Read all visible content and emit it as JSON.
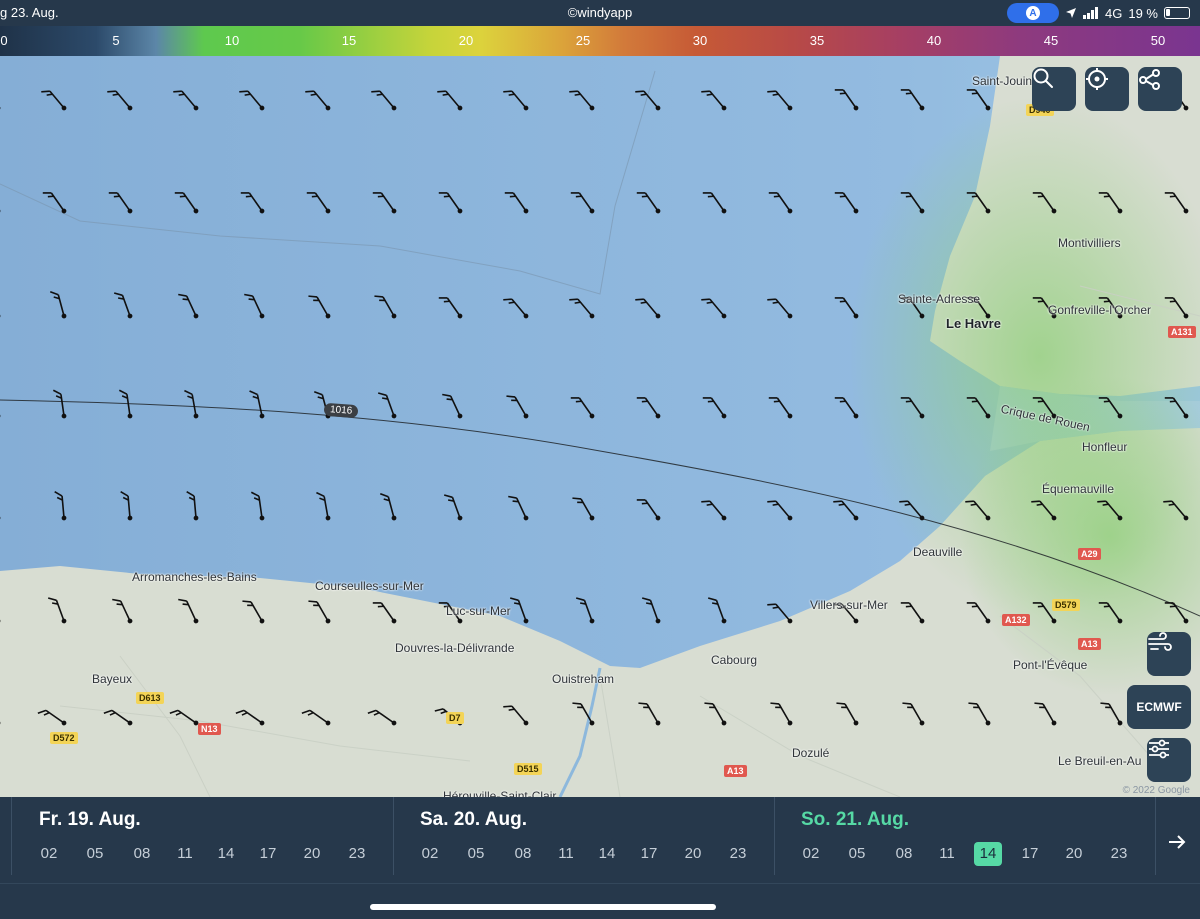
{
  "status_bar": {
    "date": "g 23. Aug.",
    "app_credit": "©windyapp",
    "location_pill": "A",
    "signal": "4G",
    "battery": "19 %"
  },
  "legend": {
    "unit_note": "",
    "stops": [
      "0",
      "5",
      "10",
      "15",
      "20",
      "25",
      "30",
      "35",
      "40",
      "45",
      "50"
    ]
  },
  "map": {
    "isobar_label": "1016",
    "copyright": "© 2022 Google",
    "places": {
      "saint_jouin": "Saint-Jouin",
      "montivilliers": "Montivilliers",
      "sainte_adresse": "Sainte-Adresse",
      "le_havre": "Le Havre",
      "gonfreville": "Gonfreville-l'Orcher",
      "crique": "Crique de Rouen",
      "honfleur": "Honfleur",
      "equemauville": "Équemauville",
      "deauville": "Deauville",
      "villers": "Villers-sur-Mer",
      "arromanches": "Arromanches-les-Bains",
      "courseulles": "Courseulles-sur-Mer",
      "luc": "Luc-sur-Mer",
      "douvres": "Douvres-la-Délivrande",
      "cabourg": "Cabourg",
      "ouistreham": "Ouistreham",
      "bayeux": "Bayeux",
      "pont_leveque": "Pont-l'Évêque",
      "dozule": "Dozulé",
      "le_breuil": "Le Breuil-en-Au",
      "herouville": "Hérouville-Saint-Clair"
    },
    "roads": [
      "D940",
      "A131",
      "A29",
      "D579",
      "A132",
      "A13",
      "A13",
      "D613",
      "N13",
      "D572",
      "D7",
      "D515"
    ],
    "buttons": {
      "search": "search",
      "locate": "locate",
      "share": "share",
      "wind_layer": "wind",
      "model": "ECMWF",
      "settings": "filters"
    }
  },
  "wind": {
    "unit": "",
    "barb_angles_deg": [
      [
        -40,
        -40,
        -40,
        -40,
        -40,
        -40,
        -40,
        -40,
        -40,
        -40,
        -40,
        -40,
        -40,
        -35,
        -35,
        -35,
        -35,
        -35,
        -35
      ],
      [
        -35,
        -35,
        -35,
        -35,
        -35,
        -35,
        -35,
        -35,
        -35,
        -35,
        -35,
        -35,
        -35,
        -35,
        -35,
        -35,
        -35,
        -35,
        -35
      ],
      [
        -15,
        -15,
        -20,
        -25,
        -25,
        -30,
        -30,
        -35,
        -40,
        -40,
        -40,
        -40,
        -40,
        -35,
        -35,
        -35,
        -35,
        -35,
        -35
      ],
      [
        -10,
        -8,
        -8,
        -10,
        -12,
        -15,
        -20,
        -25,
        -30,
        -35,
        -35,
        -35,
        -35,
        -35,
        -35,
        -35,
        -35,
        -35,
        -35
      ],
      [
        -8,
        -5,
        -5,
        -5,
        -8,
        -10,
        -15,
        -20,
        -25,
        -30,
        -35,
        -40,
        -40,
        -40,
        -40,
        -40,
        -40,
        -40,
        -40
      ],
      [
        -20,
        -20,
        -25,
        -25,
        -30,
        -30,
        -35,
        -35,
        -20,
        -20,
        -20,
        -20,
        -40,
        -40,
        -35,
        -35,
        -35,
        -35,
        -35
      ],
      [
        -55,
        -55,
        -55,
        -55,
        -55,
        -55,
        -55,
        -50,
        -40,
        -30,
        -30,
        -30,
        -30,
        -30,
        -30,
        -30,
        -30,
        -30,
        -30
      ]
    ]
  },
  "timeline": {
    "days": [
      {
        "label": "Fr. 19. Aug.",
        "hours": [
          "02",
          "05",
          "08",
          "11",
          "14",
          "17",
          "20",
          "23"
        ],
        "selected_hour": null
      },
      {
        "label": "Sa. 20. Aug.",
        "hours": [
          "02",
          "05",
          "08",
          "11",
          "14",
          "17",
          "20",
          "23"
        ],
        "selected_hour": null
      },
      {
        "label": "So. 21. Aug.",
        "hours": [
          "02",
          "05",
          "08",
          "11",
          "14",
          "17",
          "20",
          "23"
        ],
        "selected_hour": "14"
      }
    ],
    "active_day_color": "#56d9a5"
  },
  "colors": {
    "ui_dark": "#26384b",
    "accent": "#56d9a5",
    "sea": "#8fb4d8",
    "land": "#d7ddd2"
  }
}
